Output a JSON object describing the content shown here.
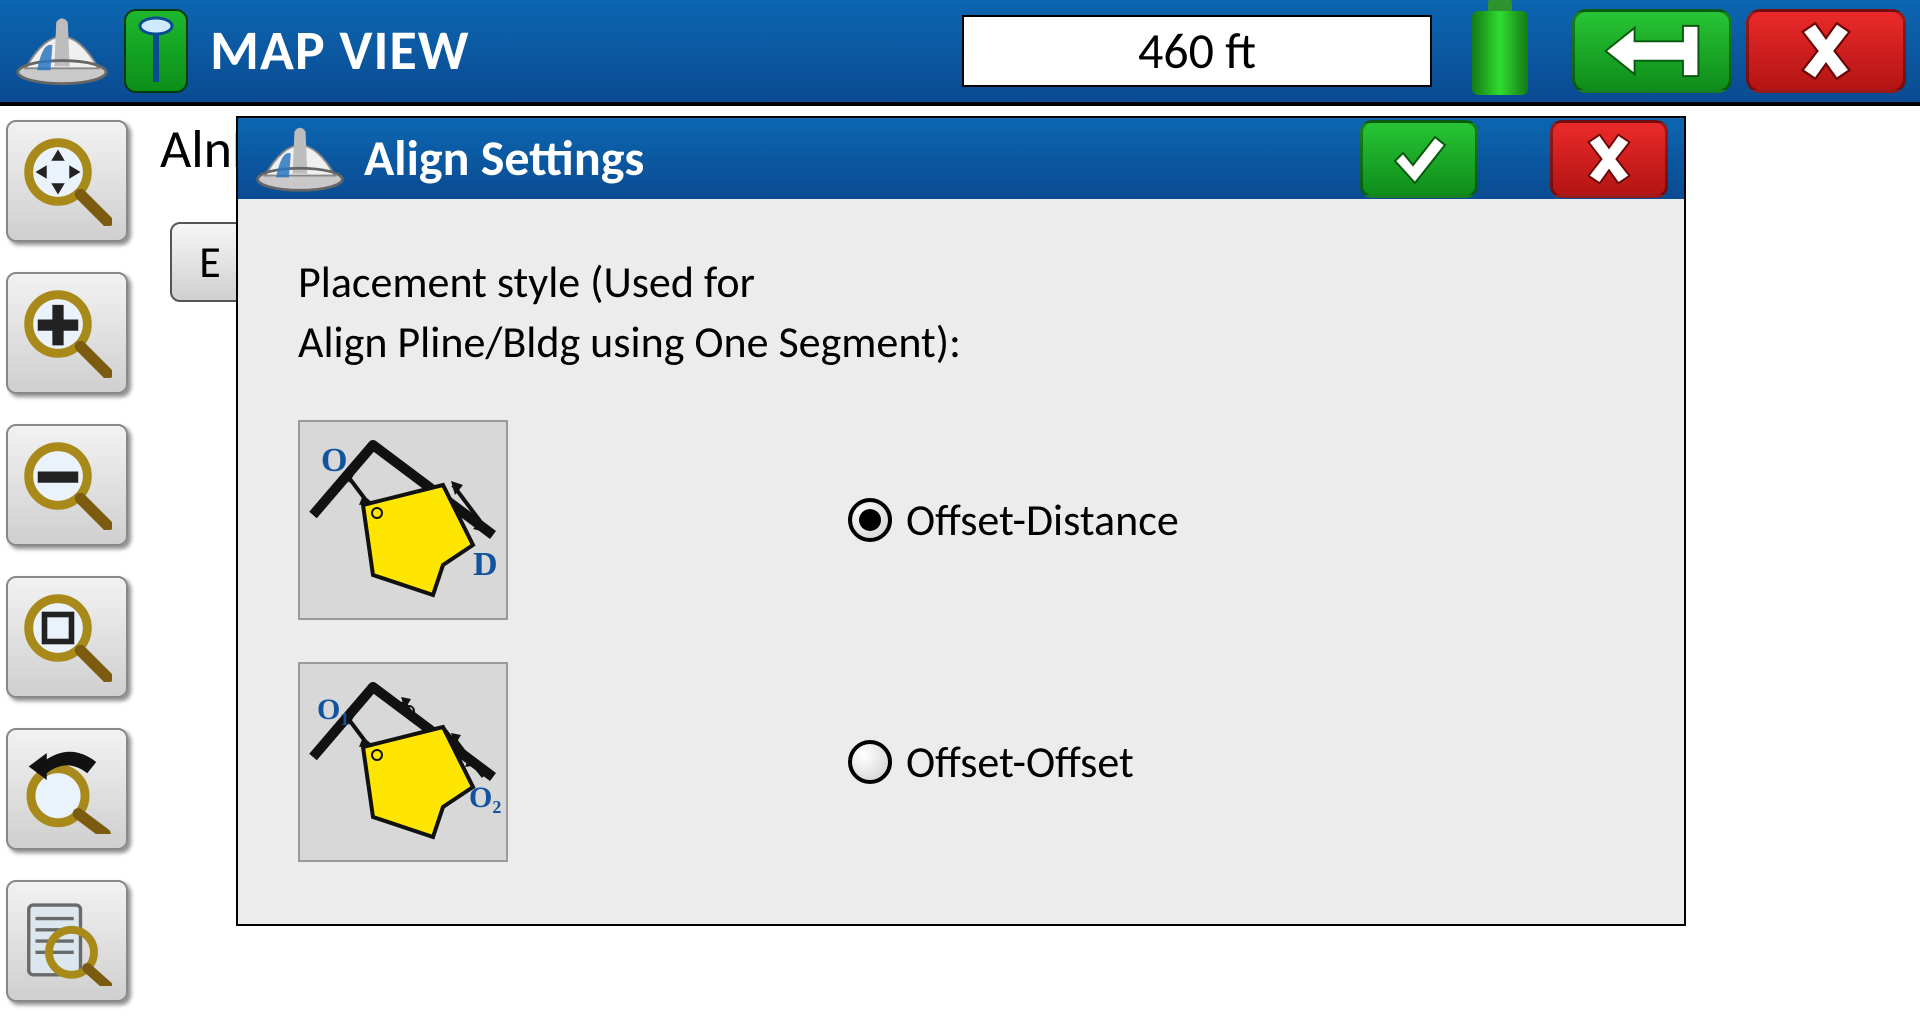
{
  "topbar": {
    "title": "MAP VIEW",
    "distance": "460 ft"
  },
  "background": {
    "partial_text": "AlnB",
    "button_text": "E"
  },
  "dialog": {
    "title": "Align Settings",
    "prompt_line1": "Placement style (Used for",
    "prompt_line2": "Align Pline/Bldg using One Segment):",
    "options": [
      {
        "label": "Offset-Distance",
        "selected": true,
        "annot1": "O",
        "annot2": "D"
      },
      {
        "label": "Offset-Offset",
        "selected": false,
        "annot1": "O₁",
        "annot2": "O₂"
      }
    ]
  }
}
